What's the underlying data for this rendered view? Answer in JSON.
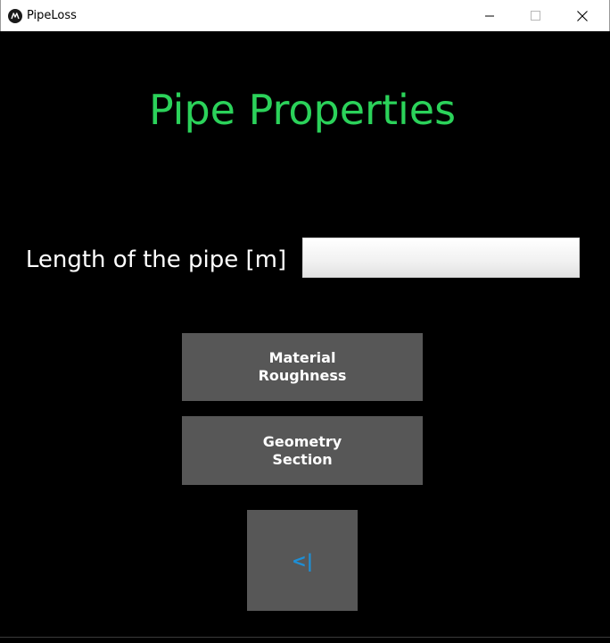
{
  "window": {
    "title": "PipeLoss",
    "app_icon": "kivy-logo-icon",
    "controls": {
      "minimize_icon": "minimize-icon",
      "maximize_icon": "maximize-icon",
      "close_icon": "close-icon"
    }
  },
  "main": {
    "title": "Pipe Properties",
    "length_field": {
      "label": "Length of the pipe [m]",
      "value": "",
      "placeholder": ""
    },
    "buttons": {
      "material_line1": "Material",
      "material_line2": "Roughness",
      "geometry_line1": "Geometry",
      "geometry_line2": "Section",
      "back_label": "<|"
    }
  },
  "colors": {
    "background": "#000000",
    "title_green": "#2bd25a",
    "button_gray": "#575757",
    "back_glyph_blue": "#1e8fd6"
  }
}
